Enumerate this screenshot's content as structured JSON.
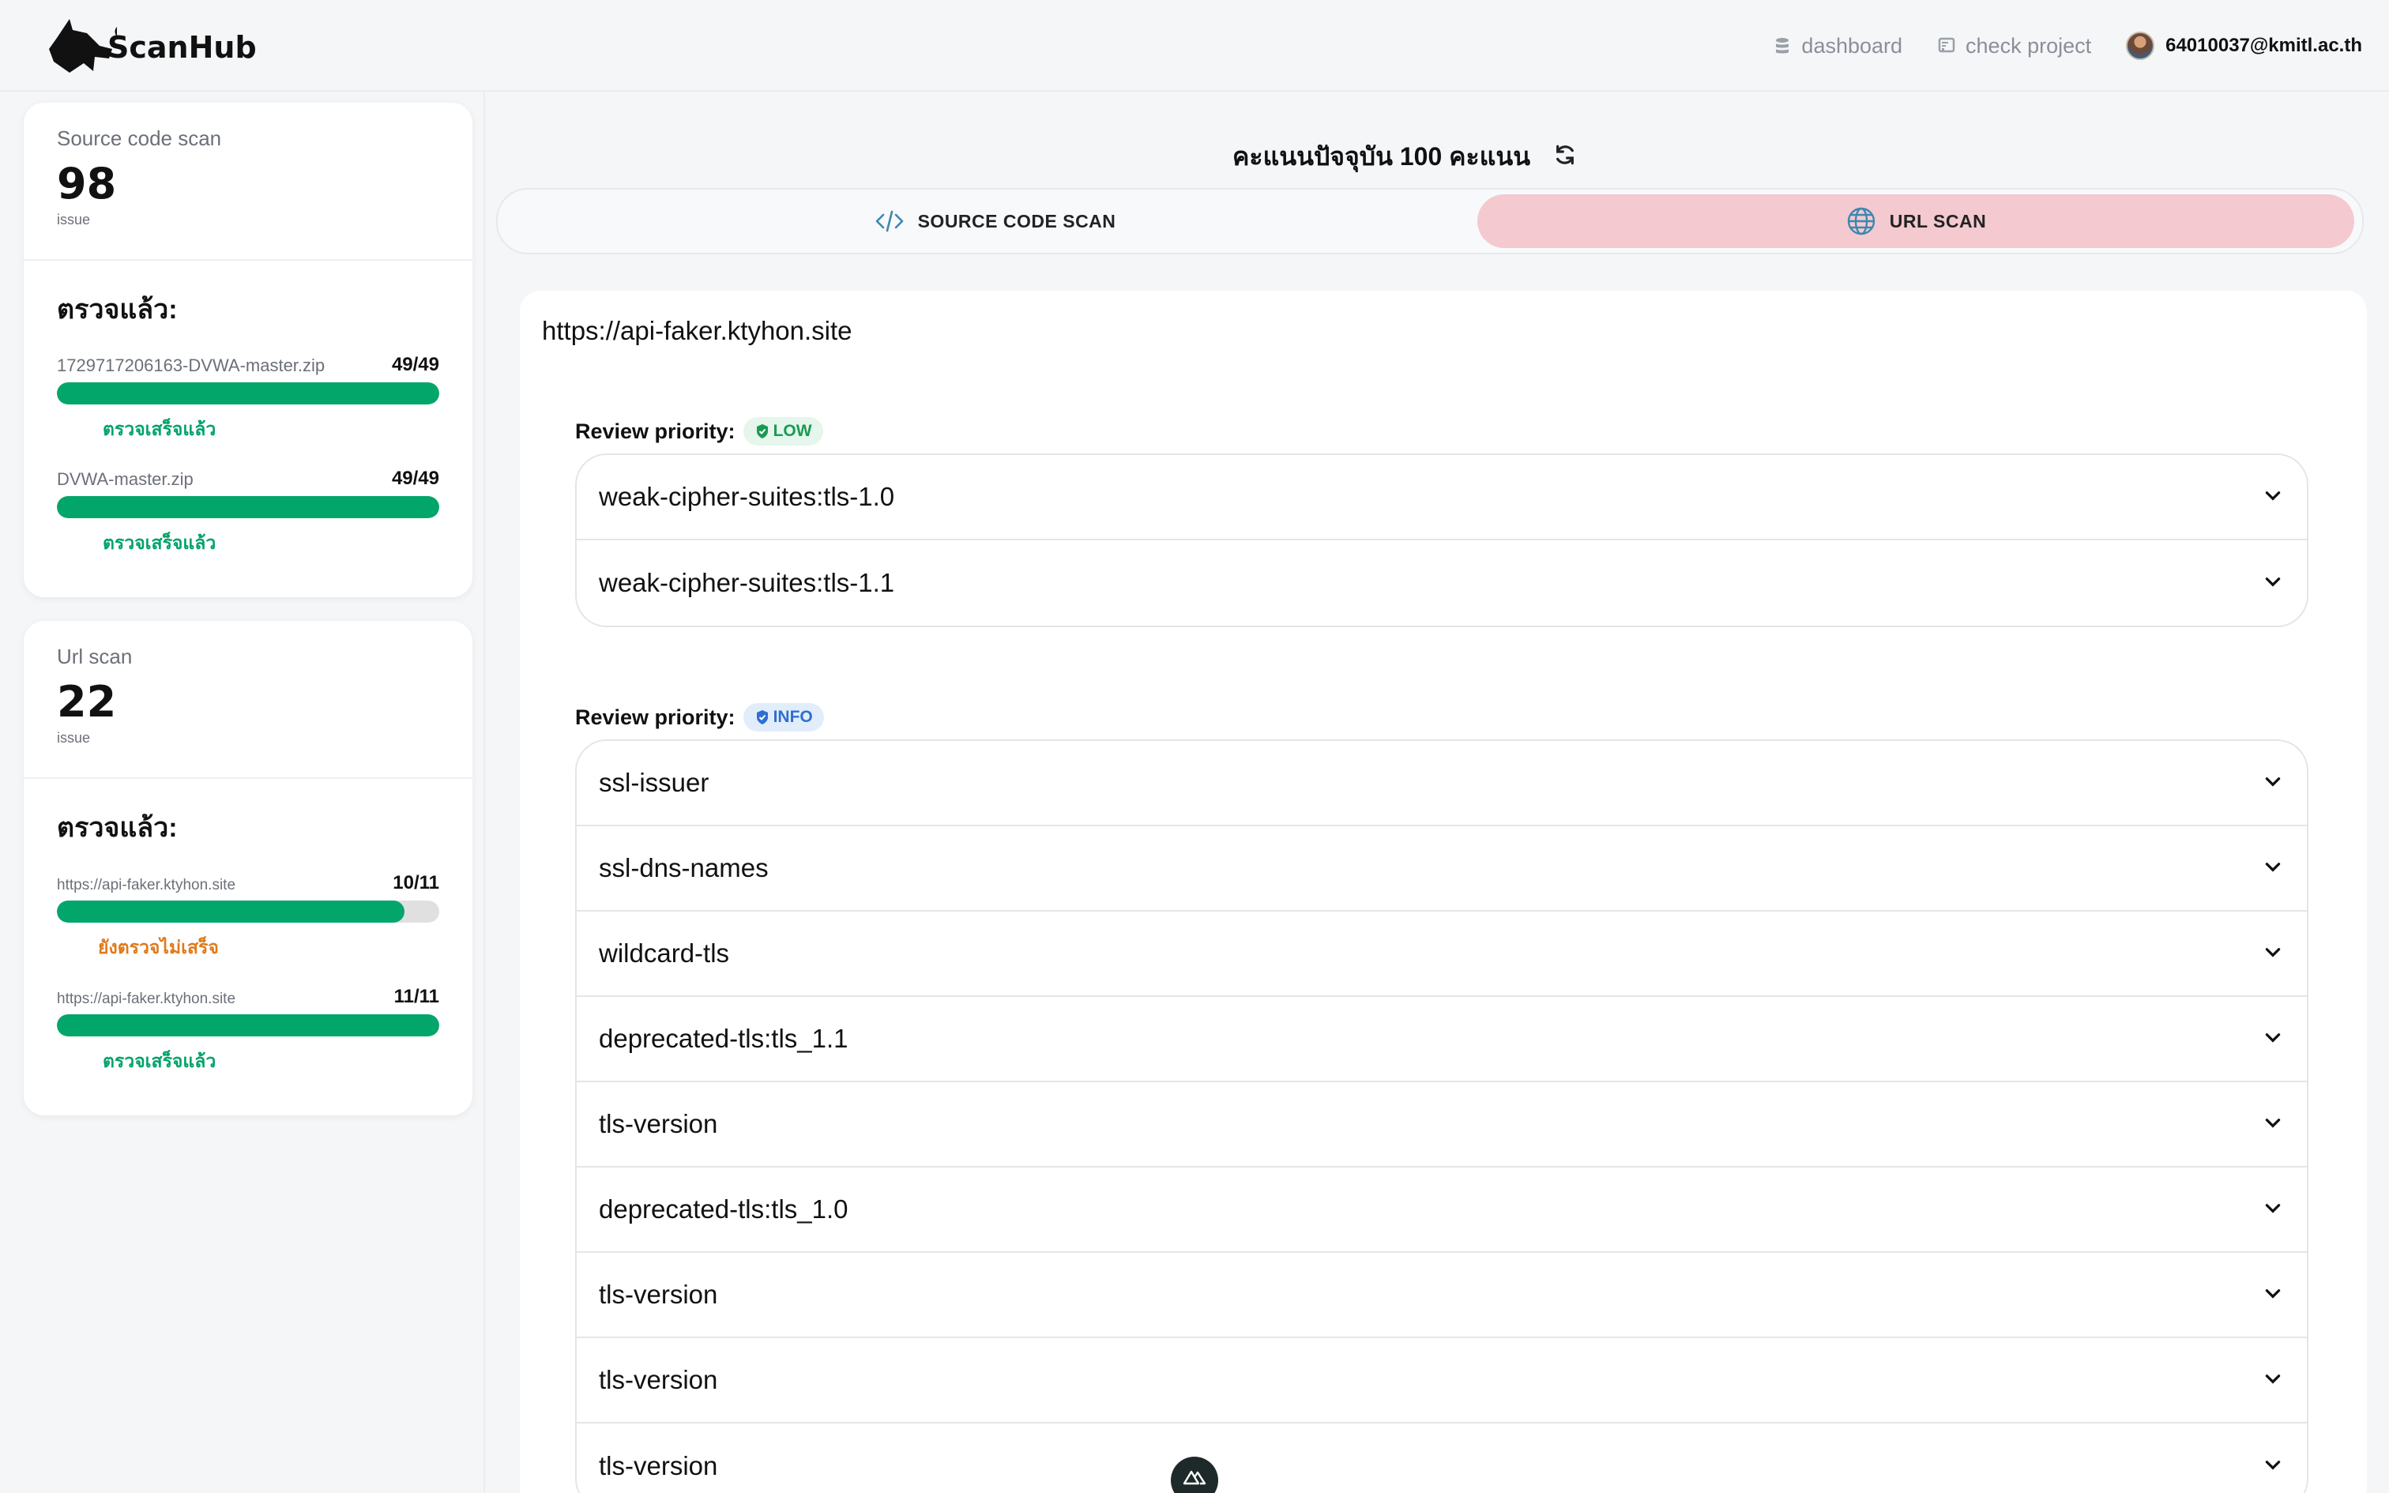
{
  "header": {
    "brand": "ScanHub",
    "nav": [
      {
        "label": "dashboard",
        "icon": "database-icon"
      },
      {
        "label": "check project",
        "icon": "project-icon"
      }
    ],
    "user": {
      "email": "64010037@kmitl.ac.th"
    }
  },
  "sidebar": {
    "source_card": {
      "label": "Source code scan",
      "count": "98",
      "unit": "issue",
      "checked_title": "ตรวจแล้ว:",
      "items": [
        {
          "name": "1729717206163-DVWA-master.zip",
          "ratio": "49/49",
          "progress": 1.0,
          "status": "ตรวจเสร็จแล้ว"
        },
        {
          "name": "DVWA-master.zip",
          "ratio": "49/49",
          "progress": 1.0,
          "status": "ตรวจเสร็จแล้ว"
        }
      ]
    },
    "url_card": {
      "label": "Url scan",
      "count": "22",
      "unit": "issue",
      "checked_title": "ตรวจแล้ว:",
      "items": [
        {
          "name": "https://api-faker.ktyhon.site",
          "ratio": "10/11",
          "progress": 0.909,
          "status": "ยังตรวจไม่เสร็จ"
        },
        {
          "name": "https://api-faker.ktyhon.site",
          "ratio": "11/11",
          "progress": 1.0,
          "status": "ตรวจเสร็จแล้ว"
        }
      ]
    }
  },
  "main": {
    "score_text": "คะแนนปัจจุบัน 100 คะแนน",
    "tabs": [
      {
        "label": "SOURCE CODE SCAN",
        "icon": "code-icon",
        "active": false
      },
      {
        "label": "URL SCAN",
        "icon": "globe-icon",
        "active": true
      }
    ],
    "target_url": "https://api-faker.ktyhon.site",
    "groups": [
      {
        "heading": "Review priority:",
        "badge": "LOW",
        "badge_color": "#1a9a52",
        "items": [
          "weak-cipher-suites:tls-1.0",
          "weak-cipher-suites:tls-1.1"
        ]
      },
      {
        "heading": "Review priority:",
        "badge": "INFO",
        "badge_color": "#2f6fd0",
        "items": [
          "ssl-issuer",
          "ssl-dns-names",
          "wildcard-tls",
          "deprecated-tls:tls_1.1",
          "tls-version",
          "deprecated-tls:tls_1.0",
          "tls-version",
          "tls-version",
          "tls-version"
        ]
      }
    ]
  },
  "colors": {
    "accent_green": "#03a66a",
    "pending_orange": "#e07a1b",
    "active_tab": "#f4c9d0"
  }
}
